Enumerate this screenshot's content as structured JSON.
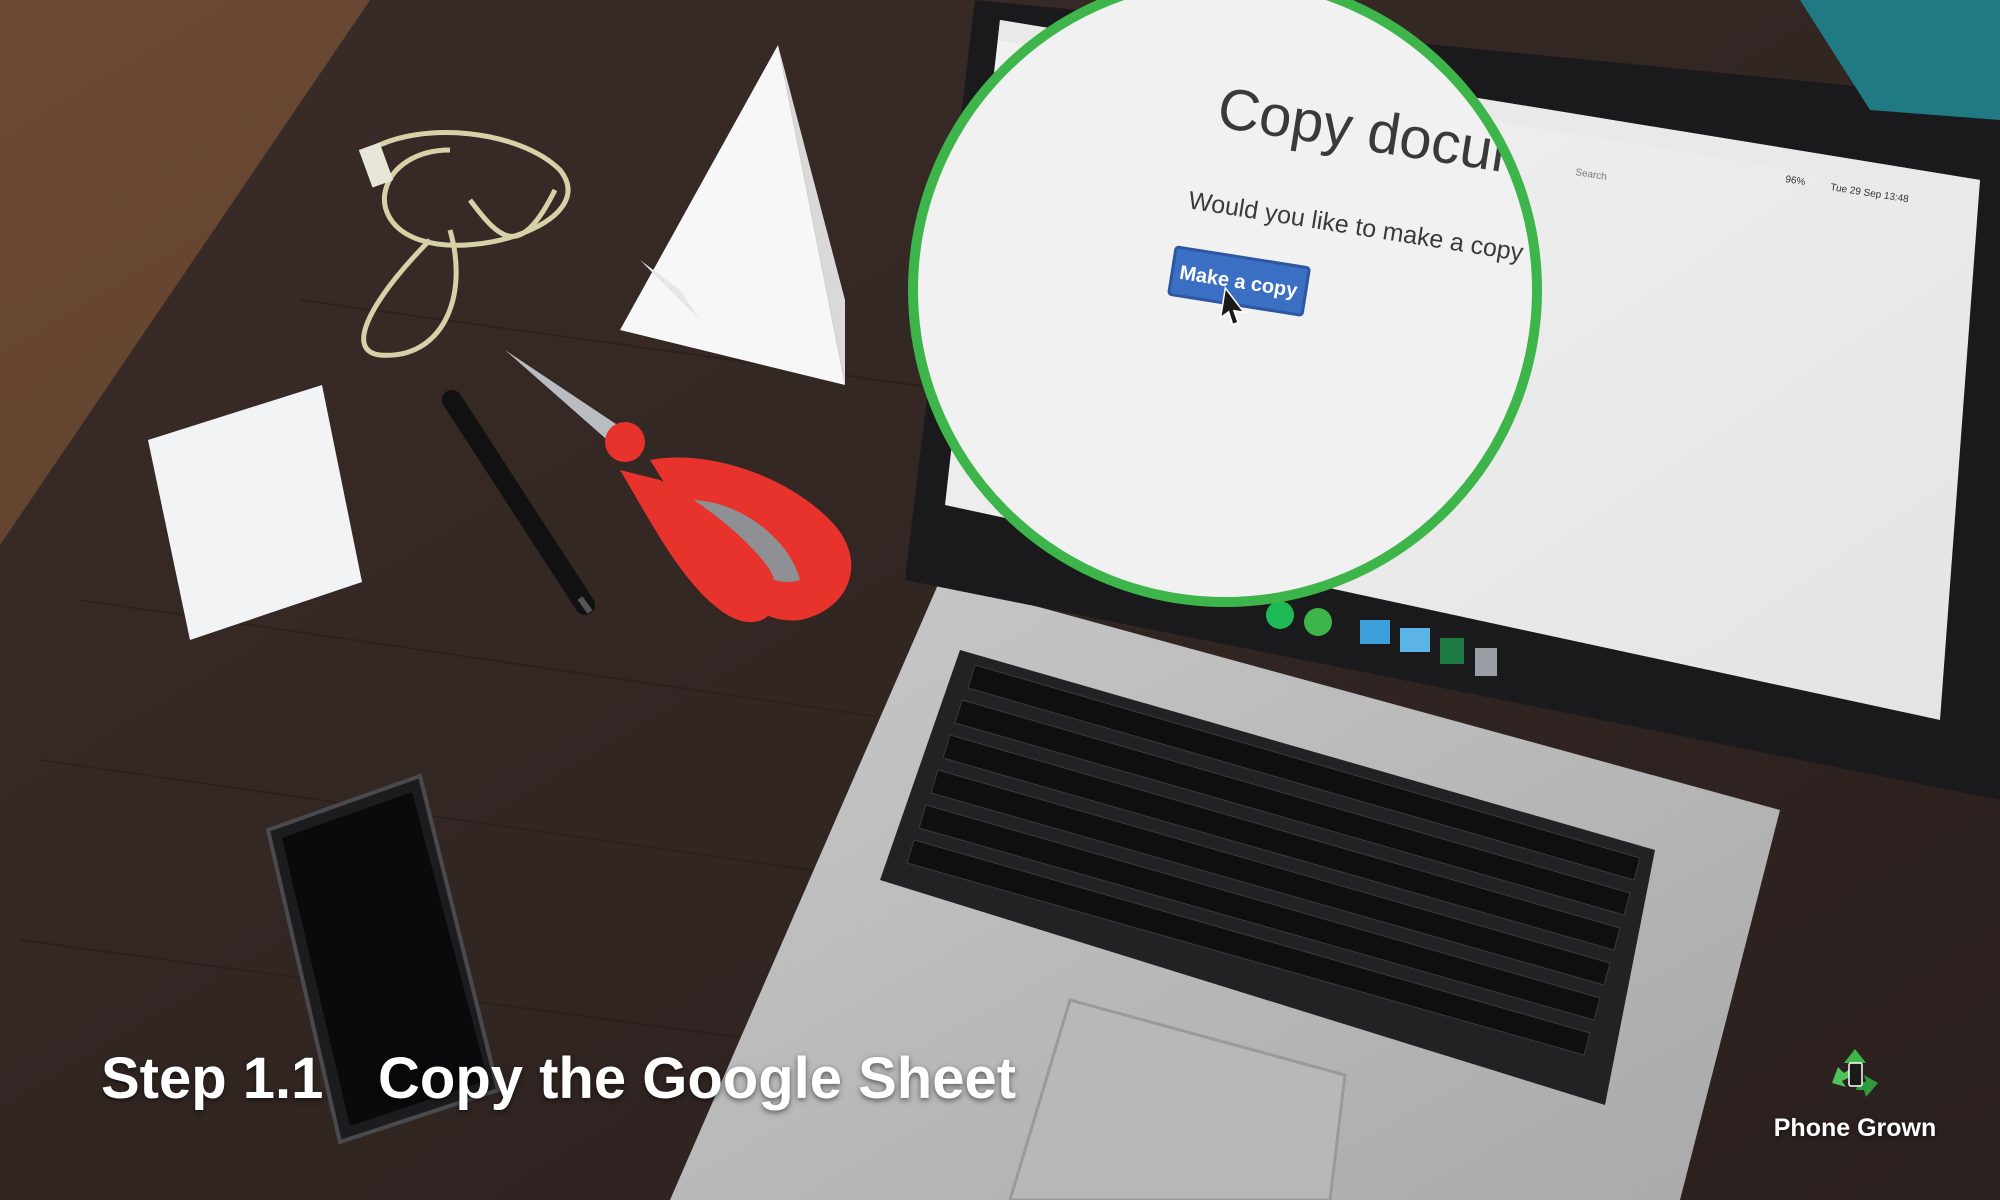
{
  "zoom": {
    "heading": "Copy documen",
    "prompt": "Would you like to make a copy of",
    "button_label": "Make a copy"
  },
  "screen": {
    "menubar_clock": "Tue 29 Sep  13:48",
    "battery": "96%",
    "search_placeholder": "Search"
  },
  "caption": {
    "step_label": "Step 1.1",
    "title": "Copy the Google Sheet"
  },
  "brand": {
    "name": "Phone Grown"
  },
  "colors": {
    "zoom_ring": "#3db54a",
    "button_blue": "#3b6fc4",
    "desk": "#2b2220",
    "scissors_red": "#e8322c"
  },
  "icons": {
    "cursor": "pointer-cursor-icon",
    "logo": "recycle-phone-logo-icon"
  }
}
